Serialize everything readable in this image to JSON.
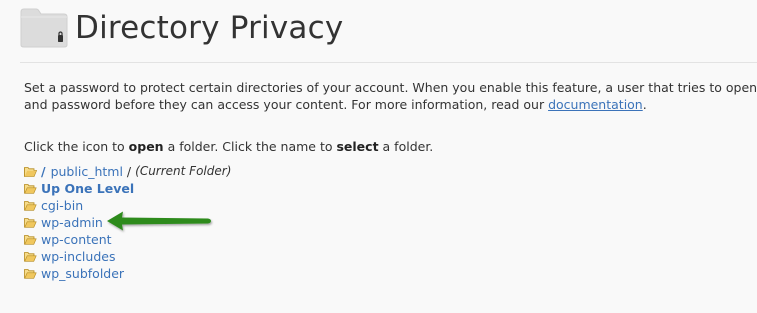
{
  "header": {
    "title": "Directory Privacy",
    "icon": "folder-lock-icon"
  },
  "description": {
    "line1": "Set a password to protect certain directories of your account. When you enable this feature, a user that tries to open a protected folder will be prompted to enter a username",
    "line2_prefix": "and password before they can access your content. For more information, read our ",
    "link_label": "documentation",
    "line2_suffix": "."
  },
  "instructions": {
    "part1": "Click the icon to ",
    "bold1": "open",
    "part2": " a folder. Click the name to ",
    "bold2": "select",
    "part3": " a folder."
  },
  "current_path": {
    "root": "/",
    "folder": "public_html",
    "separator": "/",
    "note": "(Current Folder)"
  },
  "up_one_level": "Up One Level",
  "folders": [
    {
      "name": "cgi-bin"
    },
    {
      "name": "wp-admin"
    },
    {
      "name": "wp-content"
    },
    {
      "name": "wp-includes"
    },
    {
      "name": "wp_subfolder"
    }
  ],
  "colors": {
    "link": "#3b73b9",
    "folder": "#f0c75e",
    "arrow": "#2e8b1f"
  }
}
